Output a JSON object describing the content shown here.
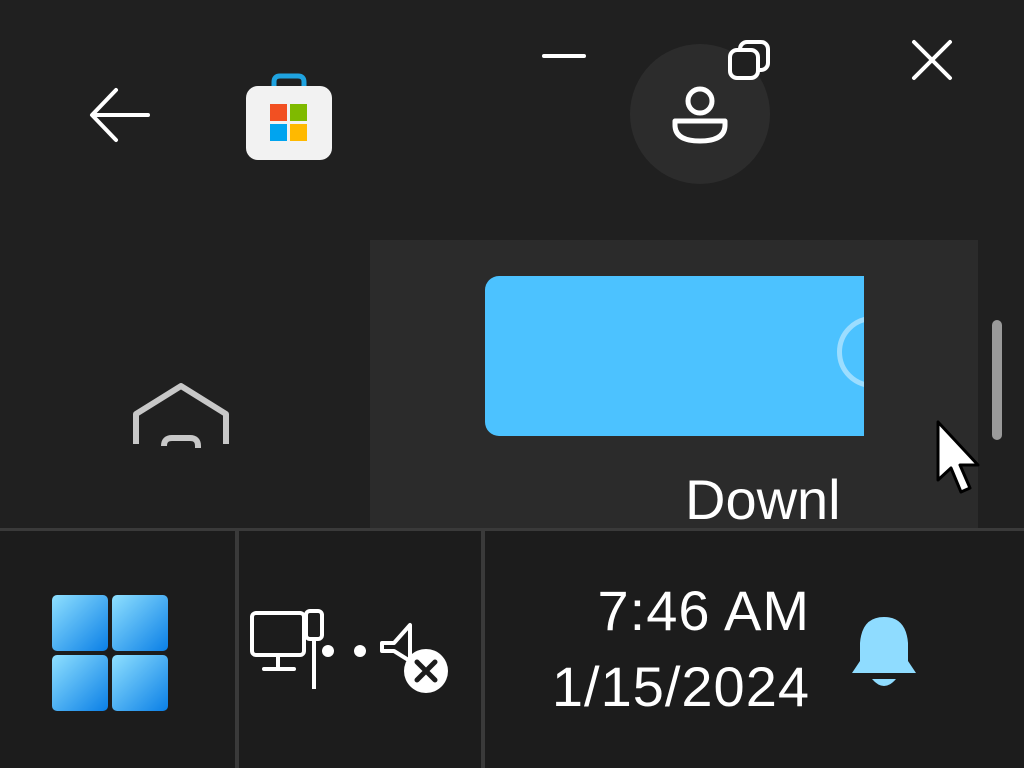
{
  "window": {
    "controls": {
      "back": "back-arrow-icon",
      "minimize": "minimize-icon",
      "restore": "restore-icon",
      "close": "close-icon"
    },
    "app_icon": "microsoft-store-icon",
    "account_icon": "person-icon"
  },
  "nav": {
    "home_icon": "home-icon"
  },
  "content": {
    "promo_card_color": "#4cc2ff",
    "download_label": "Downl"
  },
  "taskbar": {
    "start_icon": "windows-logo-icon",
    "tray": {
      "network_icon": "network-disconnected-icon",
      "volume_icon": "volume-muted-icon"
    },
    "clock": {
      "time": "7:46 AM",
      "date": "1/15/2024"
    },
    "notification_icon": "bell-icon",
    "accent_color": "#4cc2ff"
  }
}
